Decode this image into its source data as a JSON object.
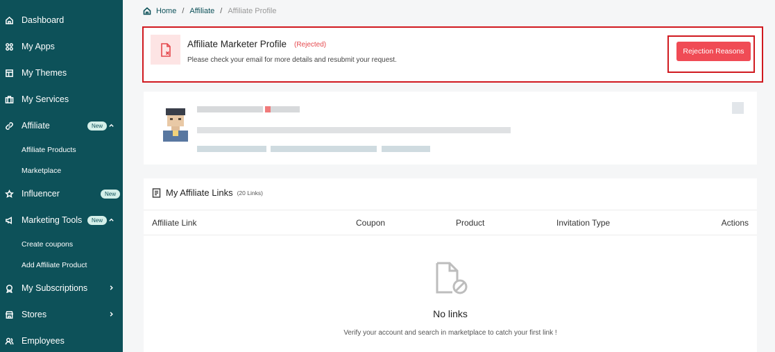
{
  "sidebar": {
    "items": [
      {
        "label": "Dashboard",
        "icon": "home-icon"
      },
      {
        "label": "My Apps",
        "icon": "apps-icon"
      },
      {
        "label": "My Themes",
        "icon": "themes-icon"
      },
      {
        "label": "My Services",
        "icon": "briefcase-icon"
      },
      {
        "label": "Affiliate",
        "icon": "link-icon",
        "badge": "New"
      },
      {
        "label": "Influencer",
        "icon": "star-icon",
        "badge": "New"
      },
      {
        "label": "Marketing Tools",
        "icon": "megaphone-icon",
        "badge": "New"
      },
      {
        "label": "My Subscriptions",
        "icon": "subscription-icon"
      },
      {
        "label": "Stores",
        "icon": "store-icon"
      },
      {
        "label": "Employees",
        "icon": "users-icon"
      }
    ],
    "affiliate_sub": [
      "Affiliate Products",
      "Marketplace"
    ],
    "marketing_sub": [
      "Create coupons",
      "Add Affiliate Product"
    ]
  },
  "breadcrumb": {
    "home": "Home",
    "section": "Affiliate",
    "current": "Affiliate Profile",
    "separator": "/"
  },
  "profile_status": {
    "title": "Affiliate Marketer Profile",
    "status": "(Rejected)",
    "description": "Please check your email for more details and resubmit your request.",
    "button": "Rejection Reasons"
  },
  "links": {
    "title": "My Affiliate Links",
    "count": "(20 Links)",
    "columns": [
      "Affiliate Link",
      "Coupon",
      "Product",
      "Invitation Type",
      "Actions"
    ],
    "empty_title": "No links",
    "empty_desc": "Verify  your account and search in marketplace to catch your first link !"
  },
  "colors": {
    "sidebar": "#0d5159",
    "accent_red": "#f04b55",
    "highlight_frame": "#d0191f"
  }
}
